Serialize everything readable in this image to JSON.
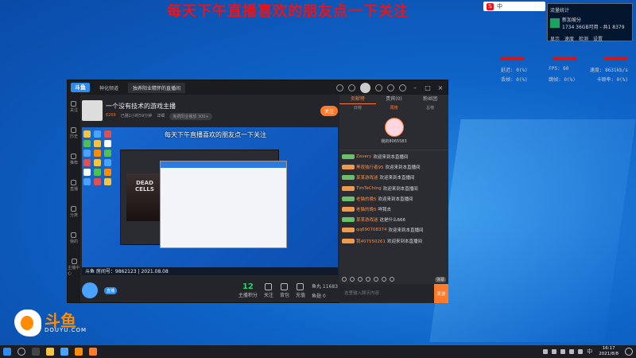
{
  "banner": "每天下午直播喜欢的朋友点一下关注",
  "app": {
    "logo": "斗鱼",
    "tabs": [
      "神化频道",
      "独养阳业精怀的直播间"
    ],
    "streamer": {
      "name": "一个没有技术的游戏主播",
      "hot": "6269",
      "live_time": "已播1小时59分钟",
      "extra": "详细",
      "tag": "免费阳业播放 300+",
      "follow": "关注"
    },
    "sidenav": [
      "关注",
      "历史",
      "推荐",
      "直播",
      "分类",
      "我的",
      "主播中心"
    ],
    "video": {
      "overlay": "每天下午直播喜欢的朋友点一下关注",
      "game_title": "DEAD CELLS",
      "caption": "斗鱼 房间号：9862123 | 2021.08.08"
    },
    "controls": {
      "live_badge": "直播",
      "score": "12",
      "score_label": "主播积分",
      "buttons": [
        "关注",
        "背包",
        "充值"
      ],
      "fans_label": "鱼丸",
      "fans": "11683",
      "fans2_label": "鱼翅",
      "fans2": "0"
    }
  },
  "chat": {
    "tabs": [
      "贡献榜",
      "贵宾(0)",
      "粉丝团"
    ],
    "subtabs": [
      "日榜",
      "周榜",
      "总榜"
    ],
    "rank_name": "我的8065583",
    "messages": [
      {
        "user": "Zevery",
        "text": "欢迎来到本直播间",
        "lv": "g"
      },
      {
        "user": "黑夜独行者95",
        "text": "欢迎来到本直播间",
        "lv": "o"
      },
      {
        "user": "某某游戏迷",
        "text": "欢迎来到本直播间",
        "lv": "g"
      },
      {
        "user": "TimTeChing",
        "text": "欢迎来到本直播间",
        "lv": "o"
      },
      {
        "user": "老猫的晚5",
        "text": "欢迎来到本直播间",
        "lv": "g"
      },
      {
        "user": "老猫的晚5",
        "text": "咩我去",
        "lv": "o"
      },
      {
        "user": "某某游戏迷",
        "text": "这是什么666",
        "lv": "g"
      },
      {
        "user": "qq690708374",
        "text": "欢迎来到本直播间",
        "lv": "o"
      },
      {
        "user": "我407550261",
        "text": "欢迎来到本直播间",
        "lv": "o"
      }
    ],
    "tag": "弹幕",
    "input_placeholder": "这里输入聊天内容",
    "send": "发送"
  },
  "tray_top": {
    "logo": "S",
    "text": "中"
  },
  "net_widget": {
    "title": "流量统计",
    "name": "新加坡分",
    "detail": "1734 36GB可用 - 共1 8379",
    "buttons": [
      "显示",
      "速度",
      "检测",
      "设置"
    ]
  },
  "stats": {
    "row2": [
      "延迟: 0(%)",
      "FPS: 60",
      "速度: 8631kb/s"
    ],
    "row3": [
      "丢帧: 0(%)",
      "跳帧: 0(%)",
      "卡顿率: 0(%)"
    ]
  },
  "douyu": {
    "brand": "斗鱼",
    "site": "DOUYU.COM"
  },
  "taskbar": {
    "time": "16:17",
    "date": "2021/8/8",
    "lang": "中"
  }
}
